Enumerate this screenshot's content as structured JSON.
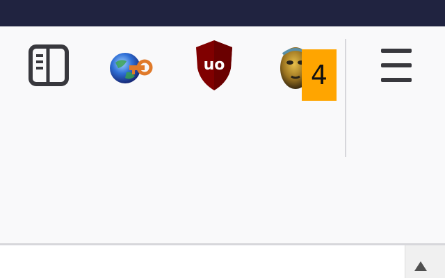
{
  "toolbar": {
    "buttons": [
      {
        "name": "sidebar-toggle",
        "icon": "sidebar-icon"
      },
      {
        "name": "extension-globe-key",
        "icon": "globe-key-icon"
      },
      {
        "name": "ublock-origin",
        "icon": "ublock-shield-icon",
        "icon_text": "uo"
      },
      {
        "name": "extension-with-badge",
        "icon": "golden-face-icon",
        "badge": "4"
      },
      {
        "name": "open-menu",
        "icon": "hamburger-menu-icon"
      }
    ]
  },
  "colors": {
    "titlebar": "#202340",
    "toolbar_bg": "#f9f9fa",
    "badge_bg": "#ffa500",
    "ublock_red": "#800000",
    "separator": "#d7d7db"
  }
}
